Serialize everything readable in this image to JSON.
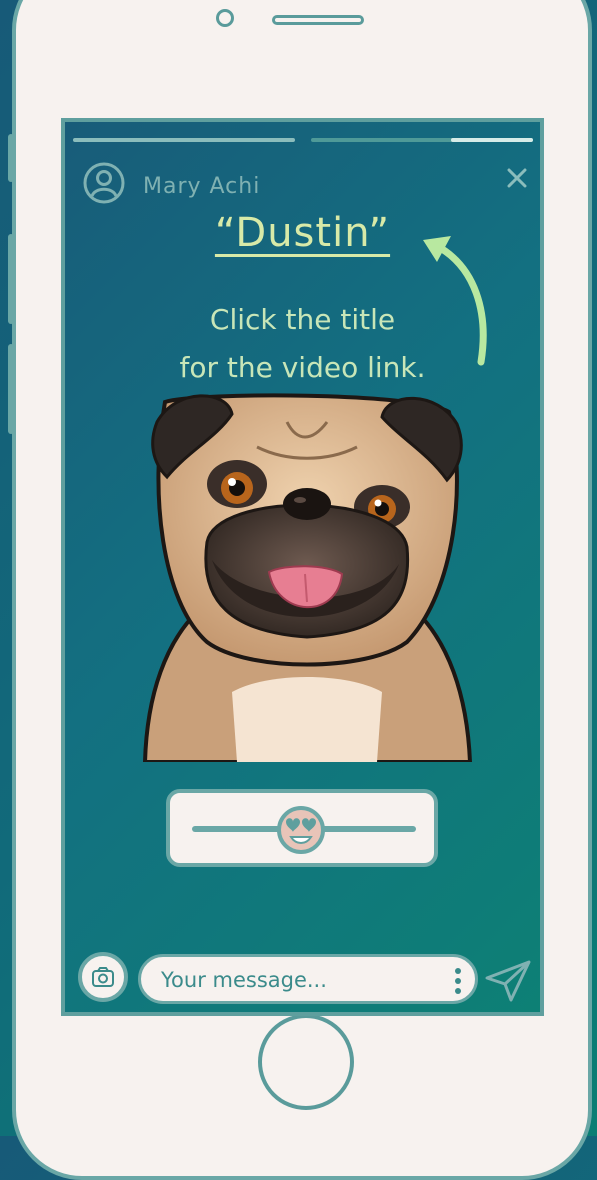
{
  "story": {
    "user_name": "Mary Achi",
    "video_title": "“Dustin”",
    "instruction_line1": "Click the title",
    "instruction_line2": "for the video link.",
    "progress_segments": [
      {
        "state": "complete"
      },
      {
        "state": "in-progress",
        "fill_fraction": 0.6
      }
    ]
  },
  "reaction_slider": {
    "emoji": "heart-eyes",
    "value_fraction": 0.5
  },
  "composer": {
    "placeholder": "Your message..."
  },
  "colors": {
    "accent": "#6aa7a6",
    "title": "#d8eaa8",
    "arrow": "#b8e8a0",
    "screen_start": "#185c79",
    "screen_end": "#0d8075",
    "phone_body": "#f7f2ef"
  },
  "icons": [
    "profile-icon",
    "close-icon",
    "curved-arrow-icon",
    "heart-eyes-emoji-icon",
    "camera-icon",
    "more-vertical-icon",
    "send-icon"
  ]
}
